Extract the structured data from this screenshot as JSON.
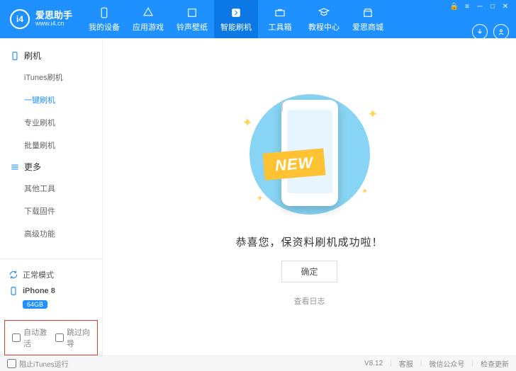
{
  "app": {
    "name": "爱思助手",
    "url": "www.i4.cn"
  },
  "nav": [
    {
      "label": "我的设备"
    },
    {
      "label": "应用游戏"
    },
    {
      "label": "铃声壁纸"
    },
    {
      "label": "智能刷机"
    },
    {
      "label": "工具箱"
    },
    {
      "label": "教程中心"
    },
    {
      "label": "爱思商城"
    }
  ],
  "sidebar": {
    "sec1": {
      "title": "刷机",
      "items": [
        "iTunes刷机",
        "一键刷机",
        "专业刷机",
        "批量刷机"
      ]
    },
    "sec2": {
      "title": "更多",
      "items": [
        "其他工具",
        "下载固件",
        "高级功能"
      ]
    }
  },
  "mode_label": "正常模式",
  "device": {
    "name": "iPhone 8",
    "storage": "64GB"
  },
  "checks": {
    "auto_activate": "自动激活",
    "skip_guide": "跳过向导"
  },
  "main": {
    "ribbon": "NEW",
    "message": "恭喜您，保资料刷机成功啦！",
    "ok": "确定",
    "log": "查看日志"
  },
  "footer": {
    "block_itunes": "阻止iTunes运行",
    "version": "V8.12",
    "links": [
      "客服",
      "微信公众号",
      "检查更新"
    ]
  }
}
